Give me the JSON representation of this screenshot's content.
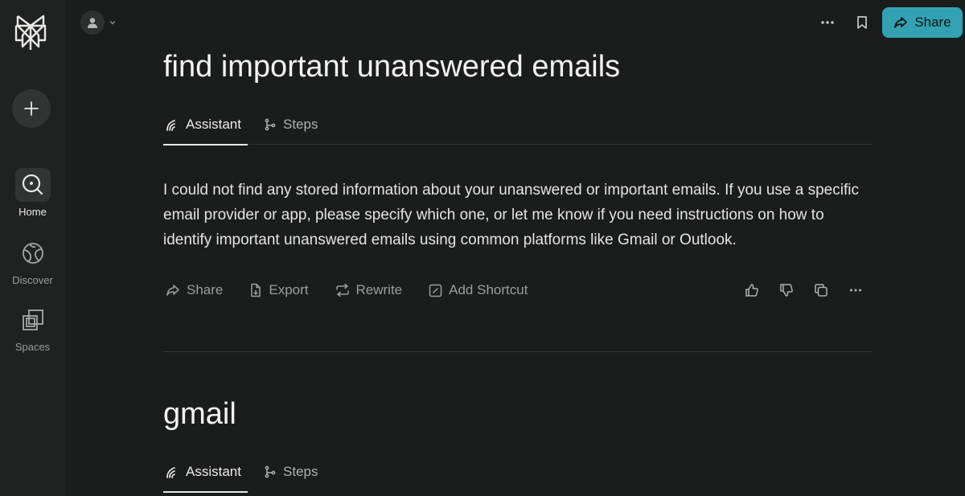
{
  "sidebar": {
    "new_thread_label": "+",
    "items": [
      {
        "label": "Home",
        "icon": "search-icon",
        "active": true
      },
      {
        "label": "Discover",
        "icon": "globe-icon",
        "active": false
      },
      {
        "label": "Spaces",
        "icon": "spaces-icon",
        "active": false
      }
    ]
  },
  "header": {
    "share_label": "Share"
  },
  "threads": [
    {
      "query": "find important unanswered emails",
      "tabs": [
        {
          "label": "Assistant",
          "active": true
        },
        {
          "label": "Steps",
          "active": false
        }
      ],
      "answer": "I could not find any stored information about your unanswered or important emails. If you use a specific email provider or app, please specify which one, or let me know if you need instructions on how to identify important unanswered emails using common platforms like Gmail or Outlook.",
      "actions": {
        "share": "Share",
        "export": "Export",
        "rewrite": "Rewrite",
        "add_shortcut": "Add Shortcut"
      }
    },
    {
      "query": "gmail",
      "tabs": [
        {
          "label": "Assistant",
          "active": true
        },
        {
          "label": "Steps",
          "active": false
        }
      ]
    }
  ],
  "colors": {
    "background": "#1b1c1c",
    "sidebar": "#202222",
    "accent": "#32a2b3"
  }
}
